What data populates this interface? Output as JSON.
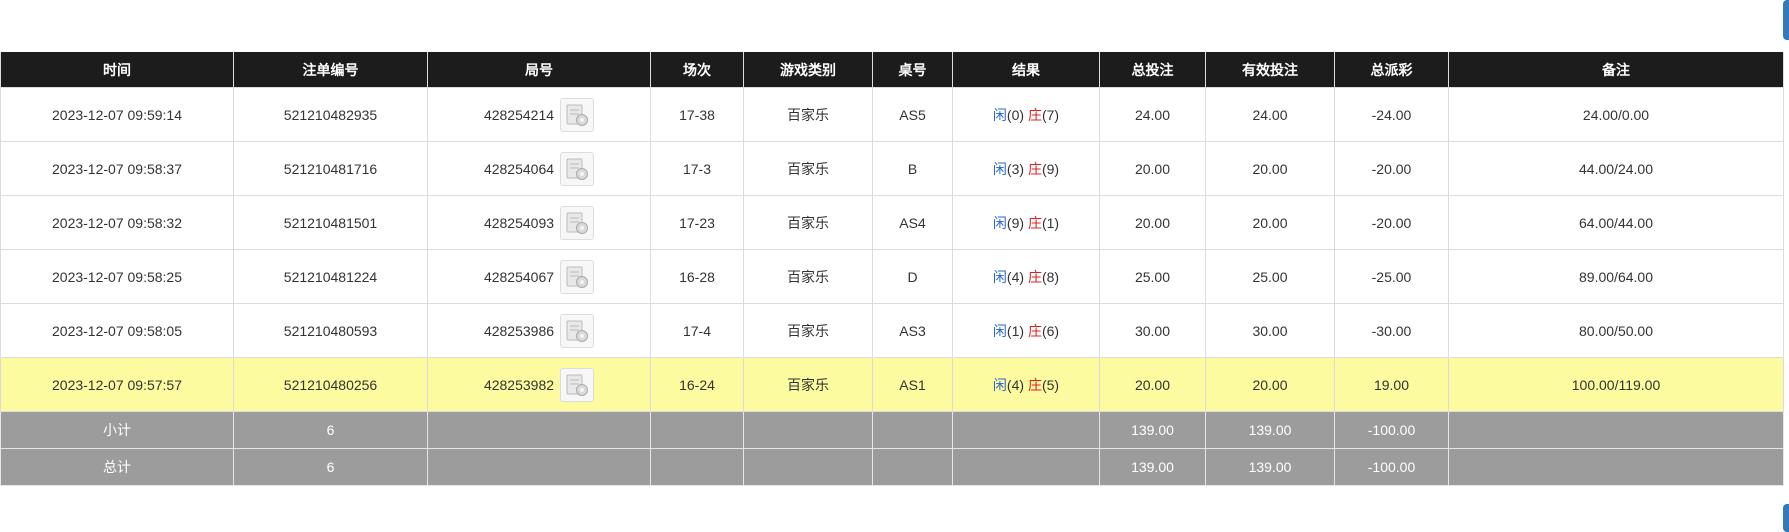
{
  "table": {
    "headers": [
      "时间",
      "注单编号",
      "局号",
      "场次",
      "游戏类别",
      "桌号",
      "结果",
      "总投注",
      "有效投注",
      "总派彩",
      "备注"
    ],
    "rows": [
      {
        "time": "2023-12-07 09:59:14",
        "bet_id": "521210482935",
        "round_id": "428254214",
        "session": "17-38",
        "game": "百家乐",
        "table": "AS5",
        "player_label": "闲",
        "player_score": "(0)",
        "banker_label": "庄",
        "banker_score": "(7)",
        "total_bet": "24.00",
        "valid_bet": "24.00",
        "payout": "-24.00",
        "note": "24.00/0.00"
      },
      {
        "time": "2023-12-07 09:58:37",
        "bet_id": "521210481716",
        "round_id": "428254064",
        "session": "17-3",
        "game": "百家乐",
        "table": "B",
        "player_label": "闲",
        "player_score": "(3)",
        "banker_label": "庄",
        "banker_score": "(9)",
        "total_bet": "20.00",
        "valid_bet": "20.00",
        "payout": "-20.00",
        "note": "44.00/24.00"
      },
      {
        "time": "2023-12-07 09:58:32",
        "bet_id": "521210481501",
        "round_id": "428254093",
        "session": "17-23",
        "game": "百家乐",
        "table": "AS4",
        "player_label": "闲",
        "player_score": "(9)",
        "banker_label": "庄",
        "banker_score": "(1)",
        "total_bet": "20.00",
        "valid_bet": "20.00",
        "payout": "-20.00",
        "note": "64.00/44.00"
      },
      {
        "time": "2023-12-07 09:58:25",
        "bet_id": "521210481224",
        "round_id": "428254067",
        "session": "16-28",
        "game": "百家乐",
        "table": "D",
        "player_label": "闲",
        "player_score": "(4)",
        "banker_label": "庄",
        "banker_score": "(8)",
        "total_bet": "25.00",
        "valid_bet": "25.00",
        "payout": "-25.00",
        "note": "89.00/64.00"
      },
      {
        "time": "2023-12-07 09:58:05",
        "bet_id": "521210480593",
        "round_id": "428253986",
        "session": "17-4",
        "game": "百家乐",
        "table": "AS3",
        "player_label": "闲",
        "player_score": "(1)",
        "banker_label": "庄",
        "banker_score": "(6)",
        "total_bet": "30.00",
        "valid_bet": "30.00",
        "payout": "-30.00",
        "note": "80.00/50.00"
      },
      {
        "time": "2023-12-07 09:57:57",
        "bet_id": "521210480256",
        "round_id": "428253982",
        "session": "16-24",
        "game": "百家乐",
        "table": "AS1",
        "player_label": "闲",
        "player_score": "(4)",
        "banker_label": "庄",
        "banker_score": "(5)",
        "total_bet": "20.00",
        "valid_bet": "20.00",
        "payout": "19.00",
        "note": "100.00/119.00"
      }
    ],
    "subtotal": {
      "label": "小计",
      "count": "6",
      "total_bet": "139.00",
      "valid_bet": "139.00",
      "payout": "-100.00"
    },
    "total": {
      "label": "总计",
      "count": "6",
      "total_bet": "139.00",
      "valid_bet": "139.00",
      "payout": "-100.00"
    },
    "highlighted_row": 5,
    "round_icon": "round-detail-icon"
  },
  "colors": {
    "header_bg": "#1c1c1c",
    "highlight_bg": "#fcfba0",
    "sum_bg": "#9c9c9c",
    "blue": "#2a66d4",
    "red": "#e02020"
  }
}
